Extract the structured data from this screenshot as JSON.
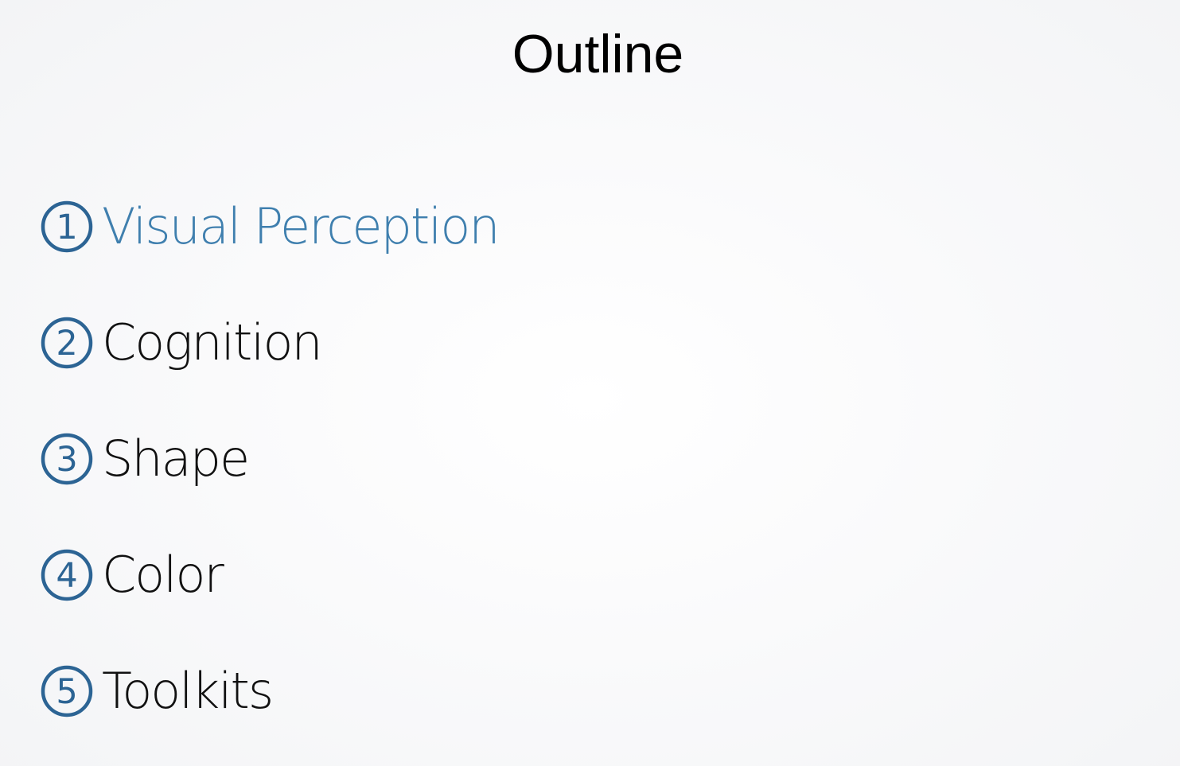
{
  "slide": {
    "title": "Outline",
    "accent_color": "#2c6494",
    "active_color": "#3f7fae",
    "items": [
      {
        "number": "1",
        "label": "Visual Perception",
        "active": true
      },
      {
        "number": "2",
        "label": "Cognition",
        "active": false
      },
      {
        "number": "3",
        "label": "Shape",
        "active": false
      },
      {
        "number": "4",
        "label": "Color",
        "active": false
      },
      {
        "number": "5",
        "label": "Toolkits",
        "active": false
      }
    ]
  }
}
